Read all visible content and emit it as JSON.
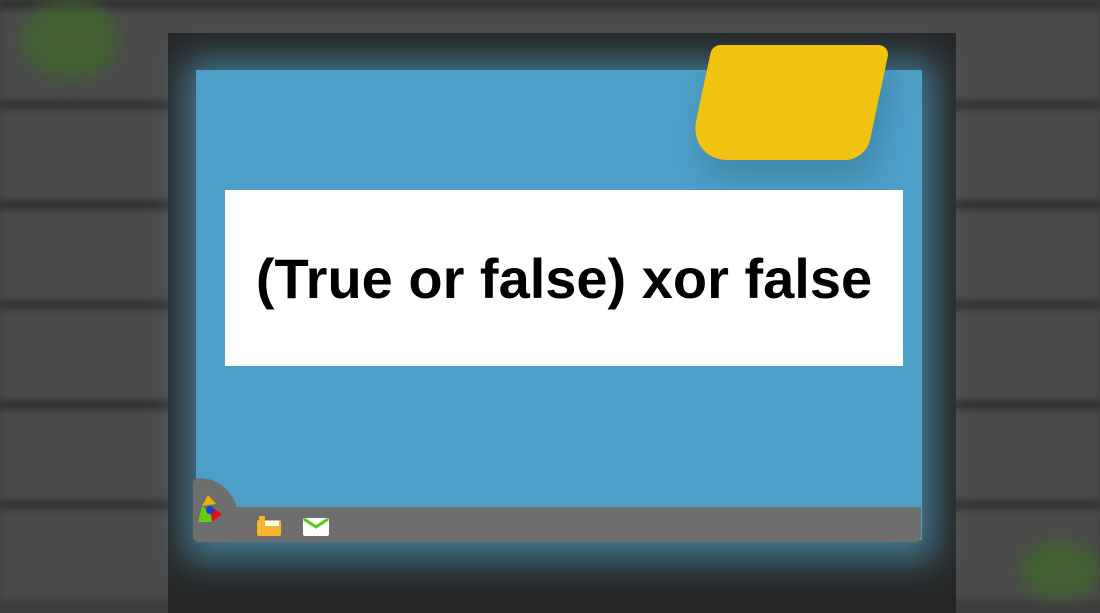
{
  "screen": {
    "text": "(True or false) xor false"
  },
  "taskbar": {
    "icons": [
      "start-logo-icon",
      "folder-icon",
      "mail-icon"
    ]
  },
  "colors": {
    "screen": "#4d9fc8",
    "sticky_note": "#efc30f",
    "taskbar": "#6e6e6e"
  }
}
